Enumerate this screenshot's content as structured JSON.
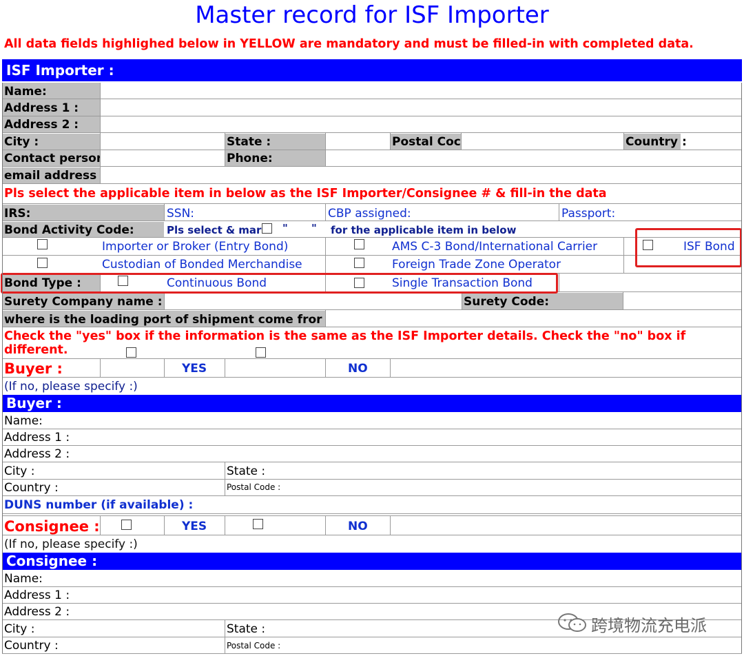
{
  "title": "Master record for ISF Importer",
  "mandatory_note": "All data fields highlighed below in YELLOW are mandatory and must be filled-in with completed data.",
  "isf_importer": {
    "header": "ISF Importer :",
    "name": "Name:",
    "address1": "Address 1 :",
    "address2": "Address 2 :",
    "city": "City :",
    "state": "State :",
    "postal": "Postal Coc",
    "country": "Country",
    "country_colon": ":",
    "contact": "Contact persor",
    "phone": "Phone:",
    "email": "email address"
  },
  "select_note": "Pls select the applicable item in below as the ISF Importer/Consignee # & fill-in the data",
  "id_types": {
    "irs": "IRS:",
    "ssn": "SSN:",
    "cbp": "CBP assigned:",
    "passport": "Passport:"
  },
  "bond": {
    "activity_label": "Bond Activity Code:",
    "activity_hint_a": "Pls select & mar",
    "activity_quote1": "\"",
    "activity_quote2": "\"",
    "activity_hint_b": "for the applicable item in below",
    "opt_importer": "Importer or Broker (Entry Bond)",
    "opt_ams": "AMS C-3 Bond/International Carrier",
    "opt_isf": "ISF Bond",
    "opt_custodian": "Custodian of Bonded Merchandise",
    "opt_ftz": "Foreign Trade Zone Operator",
    "type_label": "Bond Type :",
    "type_continuous": "Continuous Bond",
    "type_single": "Single Transaction Bond",
    "surety_company": "Surety Company name :",
    "surety_code": "Surety Code:",
    "loading_port": "where is the loading port of shipment come fror"
  },
  "check_note_line1": "Check the \"yes\" box if the information is the same as the ISF Importer details.   Check the \"no\" box if",
  "check_note_line2": "different.",
  "buyer": {
    "label": "Buyer :",
    "yes": "YES",
    "no": "NO",
    "specify": "(If no, please specify :)",
    "header": "Buyer :",
    "name": "Name:",
    "address1": "Address 1 :",
    "address2": "Address 2 :",
    "city": "City :",
    "state": "State :",
    "country": "Country :",
    "postal": "Postal Code :",
    "duns": "DUNS number (if available) :"
  },
  "consignee": {
    "label": "Consignee :",
    "yes": "YES",
    "no": "NO",
    "specify": "(If no, please specify :)",
    "header": "Consignee :",
    "name": "Name:",
    "address1": "Address 1 :",
    "address2": "Address 2 :",
    "city": "City :",
    "state": "State :",
    "country": "Country :",
    "postal": "Postal Code :"
  },
  "watermark": "跨境物流充电派",
  "colors": {
    "header_blue": "#0000ff",
    "note_red": "#ff0000",
    "label_gray": "#c0c0c0",
    "option_blue": "#1030d0"
  }
}
